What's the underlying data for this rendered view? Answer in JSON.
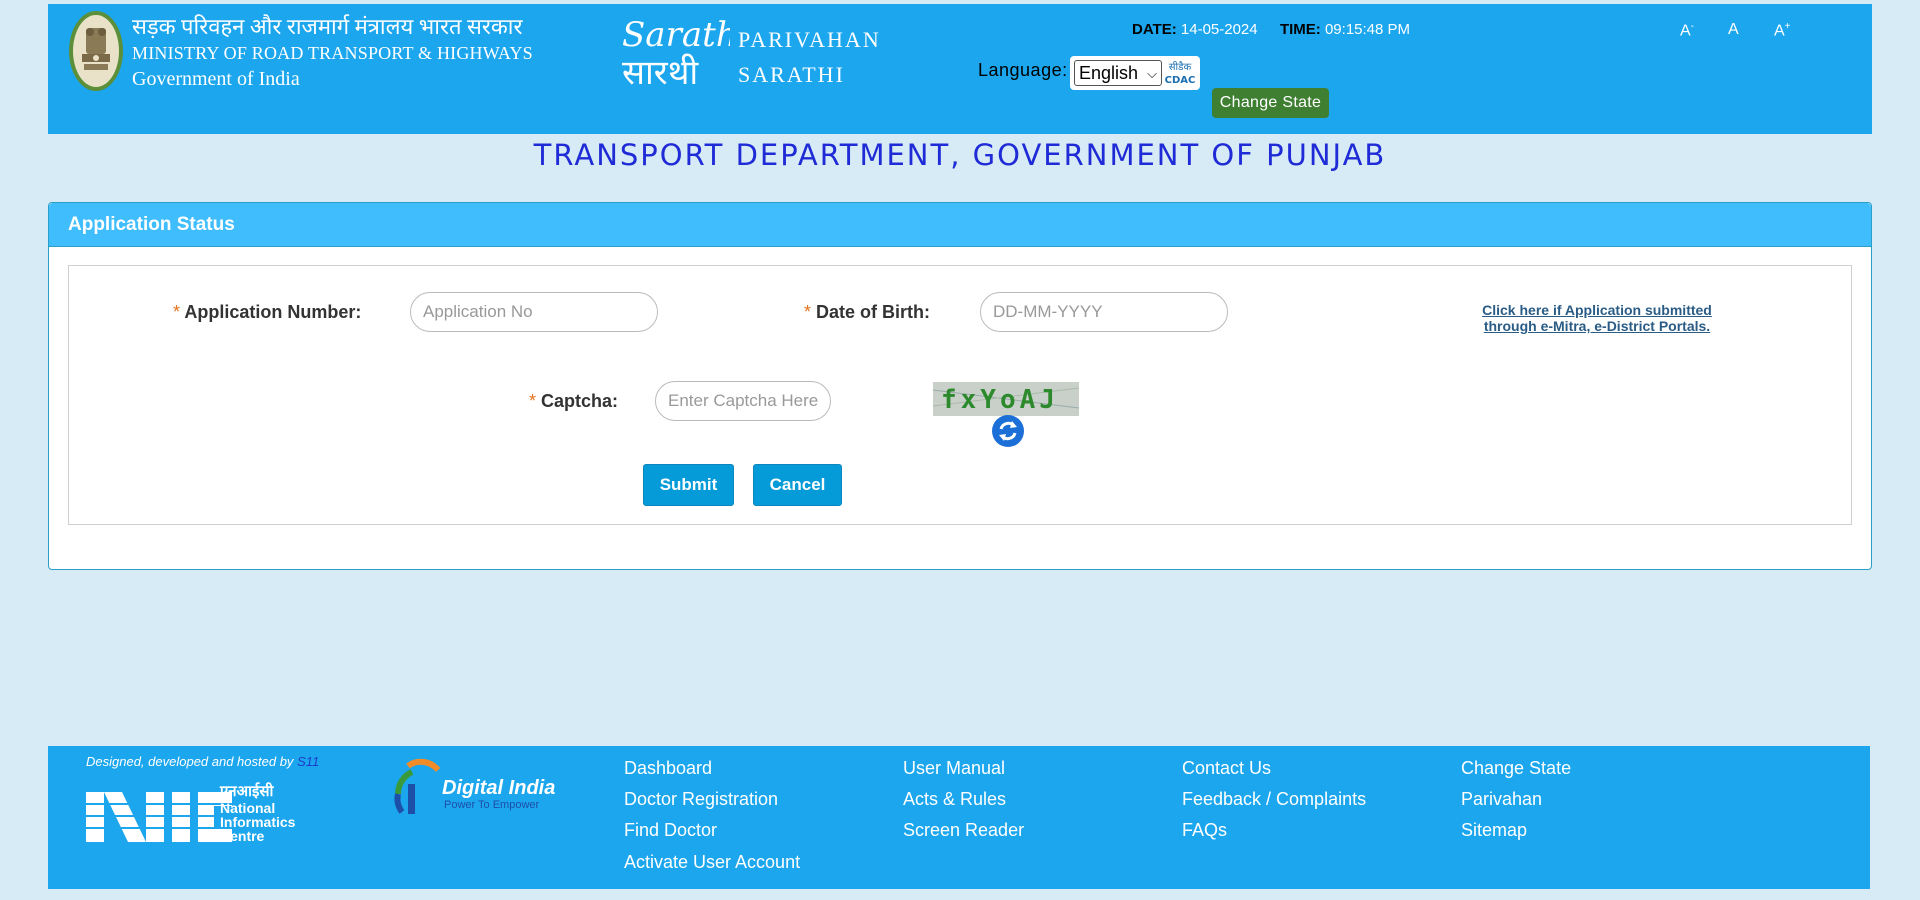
{
  "header": {
    "ministry_hindi": "सड़क परिवहन और राजमार्ग मंत्रालय भारत सरकार",
    "ministry_english": "MINISTRY OF ROAD TRANSPORT & HIGHWAYS",
    "government": "Government of India",
    "logo_text": "Sarathi",
    "logo_text_hindi": "सारथी",
    "parivahan": "PARIVAHAN",
    "sarathi": "SARATHI",
    "date_label": "DATE:",
    "date_value": "14-05-2024",
    "time_label": "TIME:",
    "time_value": "09:15:48 PM",
    "language_label": "Language:",
    "language_selected": "English",
    "cdac_label_hindi": "सीडैक",
    "cdac_label": "CDAC",
    "change_state": "Change State",
    "font_decrease": "A",
    "font_decrease_sup": "-",
    "font_normal": "A",
    "font_increase": "A",
    "font_increase_sup": "+"
  },
  "department_title": "TRANSPORT DEPARTMENT, GOVERNMENT OF PUNJAB",
  "panel": {
    "title": "Application Status",
    "required_mark": "*",
    "app_number_label": "Application Number:",
    "app_number_placeholder": "Application No",
    "dob_label": "Date of Birth:",
    "dob_placeholder": "DD-MM-YYYY",
    "emitra_link_line1": "Click here if Application submitted",
    "emitra_link_line2": "through e-Mitra, e-District Portals.",
    "captcha_label": "Captcha:",
    "captcha_placeholder": "Enter Captcha Here",
    "captcha_text": "fxYoAJ",
    "submit": "Submit",
    "cancel": "Cancel"
  },
  "footer": {
    "designed_by": "Designed, developed and hosted by",
    "designed_by_org": "S11",
    "nic_hindi": "एनआईसी",
    "nic_line1": "National",
    "nic_line2": "Informatics",
    "nic_line3": "Centre",
    "digital_india": "Digital India",
    "digital_india_tagline": "Power To Empower",
    "links": [
      "Dashboard",
      "Doctor Registration",
      "Find Doctor",
      "Activate User Account",
      "User Manual",
      "Acts & Rules",
      "Screen Reader",
      "Contact Us",
      "Feedback / Complaints",
      "FAQs",
      "Change State",
      "Parivahan",
      "Sitemap"
    ]
  },
  "colors": {
    "header_bg": "#1ba6ee",
    "page_bg": "#d6ebf5",
    "panel_head": "#40bdfc",
    "title_blue": "#1f2bd6",
    "change_state_green": "#3f7f32",
    "button_blue": "#059bd8"
  }
}
